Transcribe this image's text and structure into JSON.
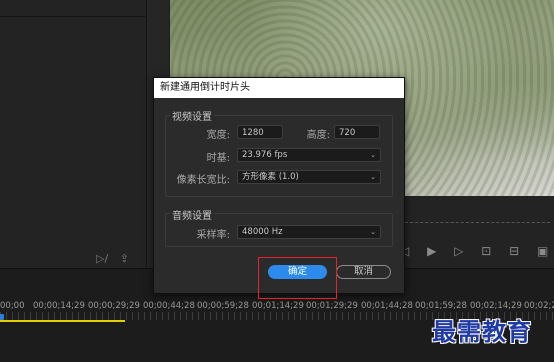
{
  "dialog": {
    "title": "新建通用倒计时片头",
    "video_section": "视频设置",
    "width_label": "宽度:",
    "width_value": "1280",
    "height_label": "高度:",
    "height_value": "720",
    "timebase_label": "时基:",
    "timebase_value": "23.976 fps",
    "pixel_aspect_label": "像素长宽比:",
    "pixel_aspect_value": "方形像素 (1.0)",
    "audio_section": "音频设置",
    "sample_rate_label": "采样率:",
    "sample_rate_value": "48000 Hz",
    "ok_label": "确定",
    "cancel_label": "取消"
  },
  "timeline": {
    "timecodes": [
      "00;00",
      "00;00;14;29",
      "00;00;29;29",
      "00;00;44;28",
      "00;00;59;28",
      "00;01;14;29",
      "00;01;29;29",
      "00;01;44;28",
      "00;01;59;28",
      "00;02;14;29",
      "00;02;29"
    ]
  },
  "watermark": "最需教育",
  "colors": {
    "accent": "#2d8ceb",
    "highlight_box": "#e0262c",
    "work_area_bar": "#e4d000",
    "playhead": "#2a7fd8"
  },
  "icons": [
    "source-insert-icon",
    "source-export-icon",
    "step-back-icon",
    "play-icon",
    "step-forward-icon",
    "lift-icon",
    "extract-icon",
    "export-frame-icon"
  ]
}
